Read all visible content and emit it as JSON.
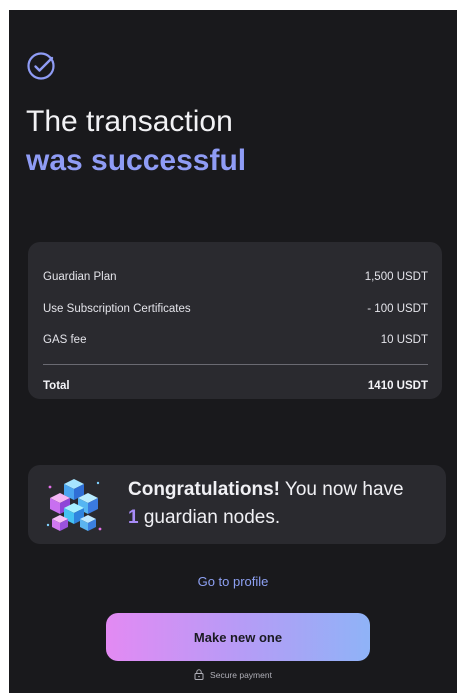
{
  "header": {
    "status_icon": "check-circle-icon",
    "title_line1": "The transaction",
    "title_line2": "was successful"
  },
  "summary": {
    "rows": [
      {
        "label": "Guardian Plan",
        "value": "1,500 USDT"
      },
      {
        "label": "Use Subscription Certificates",
        "value": "- 100 USDT"
      },
      {
        "label": "GAS fee",
        "value": "10 USDT"
      }
    ],
    "total": {
      "label": "Total",
      "value": "1410 USDT"
    }
  },
  "congrats": {
    "icon": "cubes-icon",
    "strong": "Congratulations!",
    "text_after": " You now have",
    "count": "1",
    "text_end": " guardian nodes."
  },
  "actions": {
    "profile_link": "Go to profile",
    "primary_button": "Make new one",
    "secure_label": "Secure payment",
    "secure_icon": "lock-icon"
  },
  "colors": {
    "background": "#19191c",
    "card": "#2a2a2f",
    "accent": "#8f9cf5",
    "count": "#a88cf7",
    "button_gradient_start": "#e38af3",
    "button_gradient_end": "#8fb3f7"
  }
}
